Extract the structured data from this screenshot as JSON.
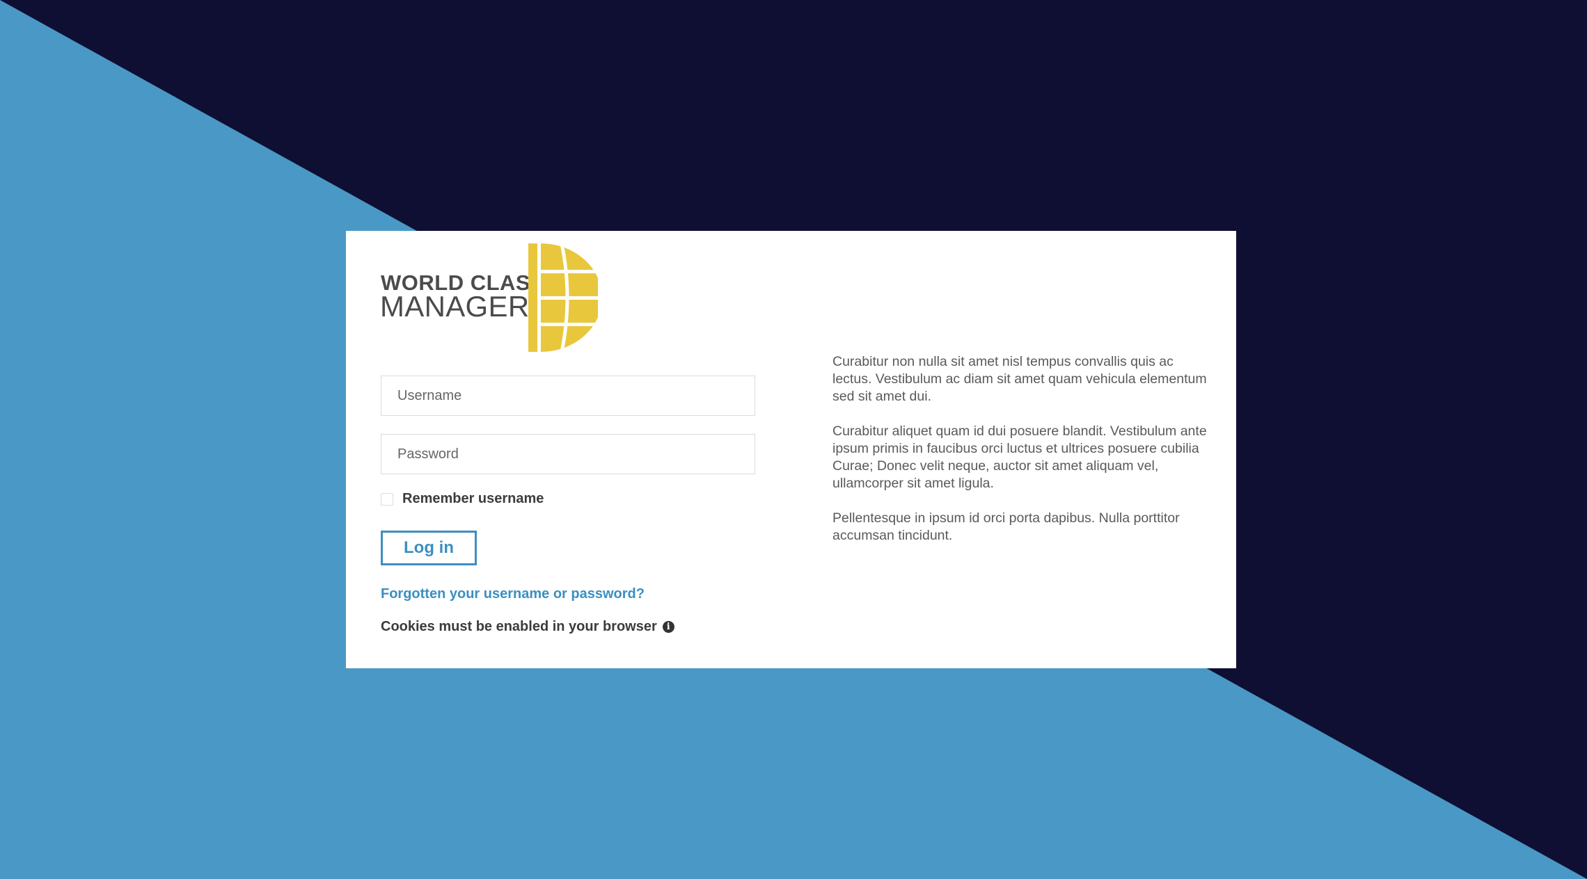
{
  "colors": {
    "background_light": "#4a98c6",
    "background_dark": "#0f0e33",
    "accent": "#3b8fc0",
    "logo_yellow": "#e8c73d",
    "logo_text": "#4b4b4b"
  },
  "logo": {
    "line1": "WORLD CLASS",
    "line2": "MANAGER",
    "icon": "globe-icon"
  },
  "form": {
    "username_placeholder": "Username",
    "username_value": "",
    "password_placeholder": "Password",
    "password_value": "",
    "remember_label": "Remember username",
    "remember_checked": false,
    "login_label": "Log in",
    "forgot_link": "Forgotten your username or password?",
    "cookies_notice": "Cookies must be enabled in your browser",
    "cookies_icon": "info-icon"
  },
  "info": {
    "paragraphs": [
      "Curabitur non nulla sit amet nisl tempus convallis quis ac lectus. Vestibulum ac diam sit amet quam vehicula elementum sed sit amet dui.",
      "Curabitur aliquet quam id dui posuere blandit. Vestibulum ante ipsum primis in faucibus orci luctus et ultrices posuere cubilia Curae; Donec velit neque, auctor sit amet aliquam vel, ullamcorper sit amet ligula.",
      "Pellentesque in ipsum id orci porta dapibus. Nulla porttitor accumsan tincidunt."
    ]
  }
}
